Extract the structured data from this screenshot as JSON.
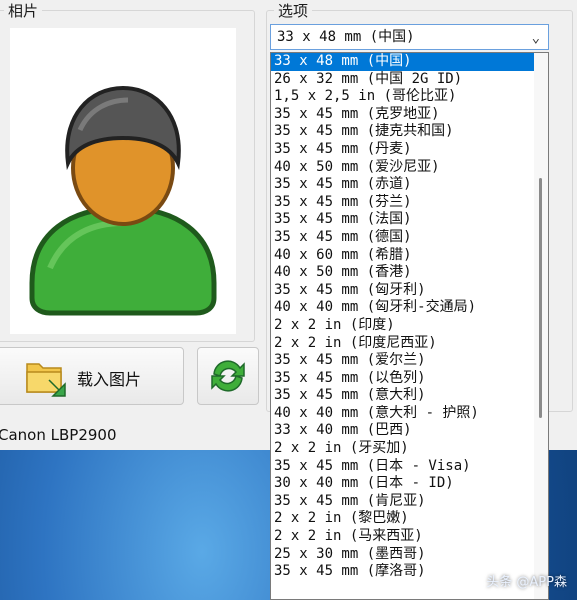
{
  "window": {
    "photo_group_label": "相片",
    "options_group_label": "选项",
    "load_button_label": "载入图片",
    "printer_name": "Canon LBP2900"
  },
  "select": {
    "current_value": "33 x 48 mm (中国)"
  },
  "dropdown_items": [
    {
      "label": "33 x 48 mm (中国)",
      "selected": true
    },
    {
      "label": "26 x 32 mm (中国 2G ID)"
    },
    {
      "label": "1,5 x 2,5 in (哥伦比亚)"
    },
    {
      "label": "35 x 45 mm (克罗地亚)"
    },
    {
      "label": "35 x 45 mm (捷克共和国)"
    },
    {
      "label": "35 x 45 mm (丹麦)"
    },
    {
      "label": "40 x 50 mm (爱沙尼亚)"
    },
    {
      "label": "35 x 45 mm (赤道)"
    },
    {
      "label": "35 x 45 mm (芬兰)"
    },
    {
      "label": "35 x 45 mm (法国)"
    },
    {
      "label": "35 x 45 mm (德国)"
    },
    {
      "label": "40 x 60 mm (希腊)"
    },
    {
      "label": "40 x 50 mm (香港)"
    },
    {
      "label": "35 x 45 mm (匈牙利)"
    },
    {
      "label": "40 x 40 mm (匈牙利-交通局)"
    },
    {
      "label": "2 x 2 in (印度)"
    },
    {
      "label": "2 x 2 in (印度尼西亚)"
    },
    {
      "label": "35 x 45 mm (爱尔兰)"
    },
    {
      "label": "35 x 45 mm (以色列)"
    },
    {
      "label": "35 x 45 mm (意大利)"
    },
    {
      "label": "40 x 40 mm (意大利 - 护照)"
    },
    {
      "label": "33 x 40 mm (巴西)"
    },
    {
      "label": "2 x 2 in (牙买加)"
    },
    {
      "label": "35 x 45 mm (日本 - Visa)"
    },
    {
      "label": "30 x 40 mm (日本 - ID)"
    },
    {
      "label": "35 x 45 mm (肯尼亚)"
    },
    {
      "label": "2 x 2 in (黎巴嫩)"
    },
    {
      "label": "2 x 2 in (马来西亚)"
    },
    {
      "label": "25 x 30 mm (墨西哥)"
    },
    {
      "label": "35 x 45 mm (摩洛哥)"
    }
  ],
  "watermark": "头条 @APP森",
  "icons": {
    "avatar": "person-silhouette-icon",
    "load": "folder-arrow-icon",
    "refresh": "refresh-arrows-icon",
    "dropdown": "chevron-down-icon"
  },
  "colors": {
    "selection": "#0078d7",
    "avatar_head": "#e0932a",
    "avatar_body": "#3fae3a",
    "avatar_cap": "#555555"
  }
}
